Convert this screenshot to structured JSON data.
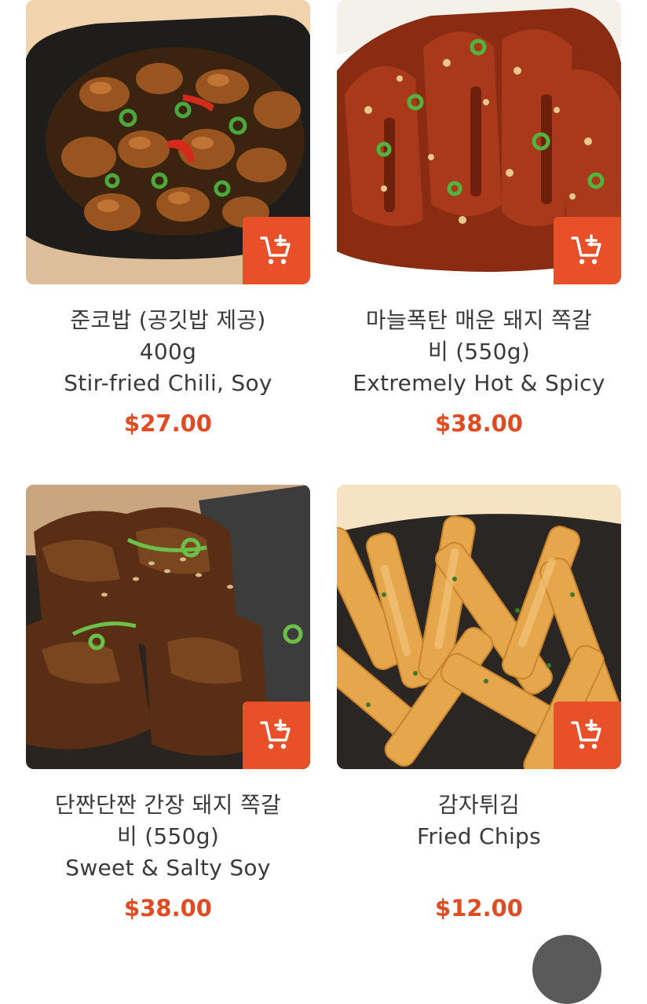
{
  "menu": {
    "items": [
      {
        "name_lines": [
          "준코밥 (공깃밥 제공)",
          "400g",
          "Stir-fried Chili, Soy"
        ],
        "price": "$27.00",
        "image": "stir-fried chicken in black skillet"
      },
      {
        "name_lines": [
          "마늘폭탄 매운 돼지 쪽갈",
          "비 (550g)",
          "Extremely Hot & Spicy"
        ],
        "price": "$38.00",
        "image": "garlic spicy pork ribs in white bowl"
      },
      {
        "name_lines": [
          "단짠단짠 간장 돼지 쪽갈",
          "비 (550g)",
          "Sweet & Salty Soy"
        ],
        "price": "$38.00",
        "image": "soy glazed pork ribs"
      },
      {
        "name_lines": [
          "감자튀김",
          "Fried Chips"
        ],
        "price": "$12.00",
        "image": "french fries"
      }
    ],
    "cart_icon": "add-to-cart-icon"
  },
  "colors": {
    "accent": "#e8502a",
    "price": "#e14b22",
    "text": "#3a3a3a"
  }
}
